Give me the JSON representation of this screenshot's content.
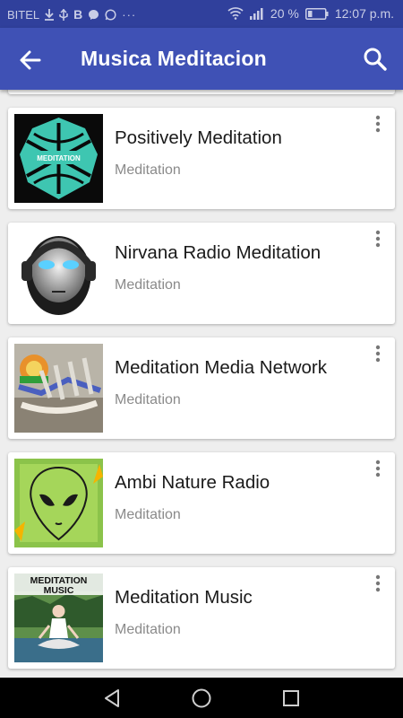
{
  "status_bar": {
    "carrier": "BITEL",
    "battery": "20 %",
    "time": "12:07 p.m."
  },
  "app_bar": {
    "title": "Musica Meditacion",
    "back_icon": "arrow-back-icon",
    "search_icon": "search-icon"
  },
  "stations": [
    {
      "title": "Positively Meditation",
      "subtitle": "Meditation",
      "image_text": "MEDITATION"
    },
    {
      "title": "Nirvana Radio Meditation",
      "subtitle": "Meditation"
    },
    {
      "title": "Meditation Media Network",
      "subtitle": "Meditation"
    },
    {
      "title": "Ambi Nature Radio",
      "subtitle": "Meditation"
    },
    {
      "title": "Meditation Music",
      "subtitle": "Meditation",
      "image_text_1": "MEDITATION",
      "image_text_2": "MUSIC"
    }
  ],
  "nav_bar": {
    "back_icon": "triangle-back-icon",
    "home_icon": "circle-home-icon",
    "recents_icon": "square-recents-icon"
  },
  "colors": {
    "primary": "#3f51b5",
    "status_bar": "#30409c",
    "background": "#eeeeee"
  }
}
